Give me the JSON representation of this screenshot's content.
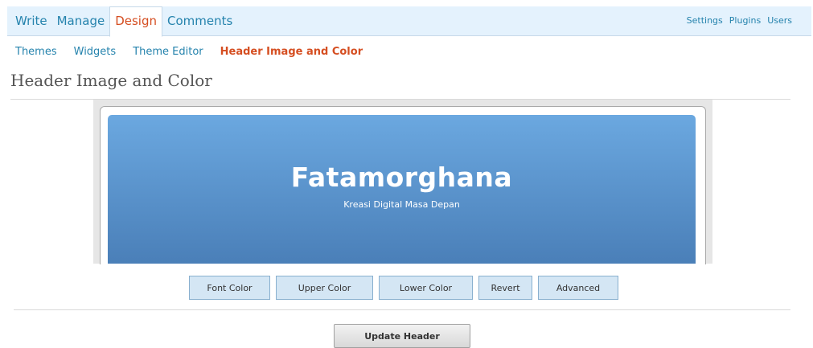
{
  "nav": {
    "tabs": [
      {
        "label": "Write"
      },
      {
        "label": "Manage"
      },
      {
        "label": "Design"
      },
      {
        "label": "Comments"
      }
    ],
    "active_tab": "Design",
    "utility_links": [
      "Settings",
      "Plugins",
      "Users"
    ]
  },
  "submenu": {
    "items": [
      "Themes",
      "Widgets",
      "Theme Editor",
      "Header Image and Color"
    ],
    "current": "Header Image and Color"
  },
  "page": {
    "title": "Header Image and Color"
  },
  "preview": {
    "blog_name": "Fatamorghana",
    "blog_description": "Kreasi Digital Masa Depan",
    "colors": {
      "font": "#ffffff",
      "upper": "#6ba8e0",
      "lower": "#4a7fb8"
    }
  },
  "controls": {
    "font_color": "Font Color",
    "upper_color": "Upper Color",
    "lower_color": "Lower Color",
    "revert": "Revert",
    "advanced": "Advanced"
  },
  "actions": {
    "update_header": "Update Header"
  }
}
